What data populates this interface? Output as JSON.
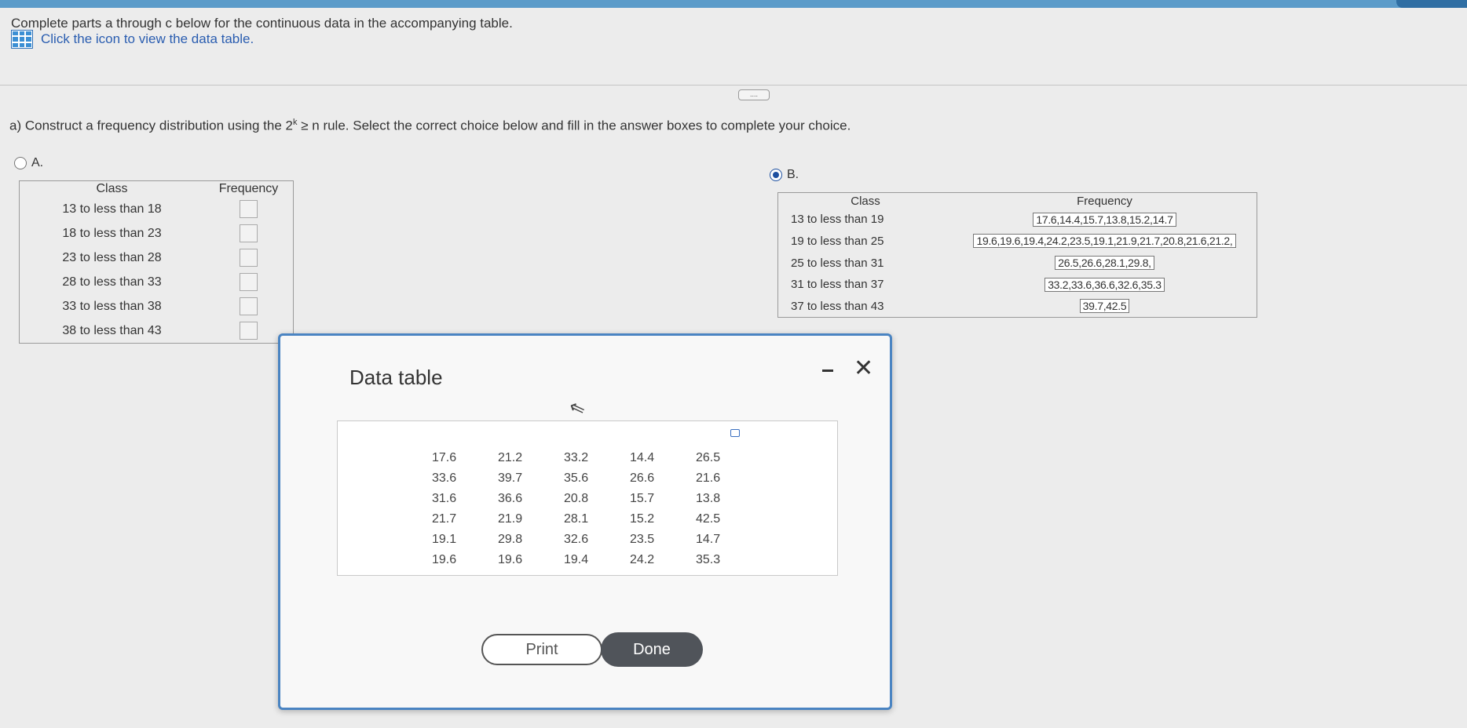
{
  "header": {
    "instructions": "Complete parts a through c below for the continuous data in the accompanying table.",
    "view_table_link": "Click the icon to view the data table."
  },
  "question_a": {
    "text_before": "a) Construct a frequency distribution using the 2",
    "superscript": "k",
    "text_after": " ≥ n rule. Select the correct choice below and fill in the answer boxes to complete your choice."
  },
  "more_button": "....",
  "option_a": {
    "label": "A.",
    "selected": false,
    "headers": {
      "class": "Class",
      "frequency": "Frequency"
    },
    "rows": [
      "13 to less than 18",
      "18 to less than 23",
      "23 to less than 28",
      "28 to less than 33",
      "33 to less than 38",
      "38 to less than 43"
    ]
  },
  "option_b": {
    "label": "B.",
    "selected": true,
    "headers": {
      "class": "Class",
      "frequency": "Frequency"
    },
    "rows": [
      {
        "class": "13 to less than 19",
        "frequency": "17.6,14.4,15.7,13.8,15.2,14.7"
      },
      {
        "class": "19 to less than 25",
        "frequency": "19.6,19.6,19.4,24.2,23.5,19.1,21.9,21.7,20.8,21.6,21.2,"
      },
      {
        "class": "25 to less than 31",
        "frequency": "26.5,26.6,28.1,29.8,"
      },
      {
        "class": "31 to less than 37",
        "frequency": "33.2,33.6,36.6,32.6,35.3"
      },
      {
        "class": "37 to less than 43",
        "frequency": "39.7,42.5"
      }
    ]
  },
  "dialog": {
    "title": "Data table",
    "data": [
      [
        "17.6",
        "21.2",
        "33.2",
        "14.4",
        "26.5"
      ],
      [
        "33.6",
        "39.7",
        "35.6",
        "26.6",
        "21.6"
      ],
      [
        "31.6",
        "36.6",
        "20.8",
        "15.7",
        "13.8"
      ],
      [
        "21.7",
        "21.9",
        "28.1",
        "15.2",
        "42.5"
      ],
      [
        "19.1",
        "29.8",
        "32.6",
        "23.5",
        "14.7"
      ],
      [
        "19.6",
        "19.6",
        "19.4",
        "24.2",
        "35.3"
      ]
    ],
    "print_label": "Print",
    "done_label": "Done",
    "close_glyph": "✕",
    "cursor_glyph": "⇖"
  },
  "colors": {
    "accent": "#4a84c2",
    "done_button": "#50545a",
    "link": "#2a5db0"
  }
}
